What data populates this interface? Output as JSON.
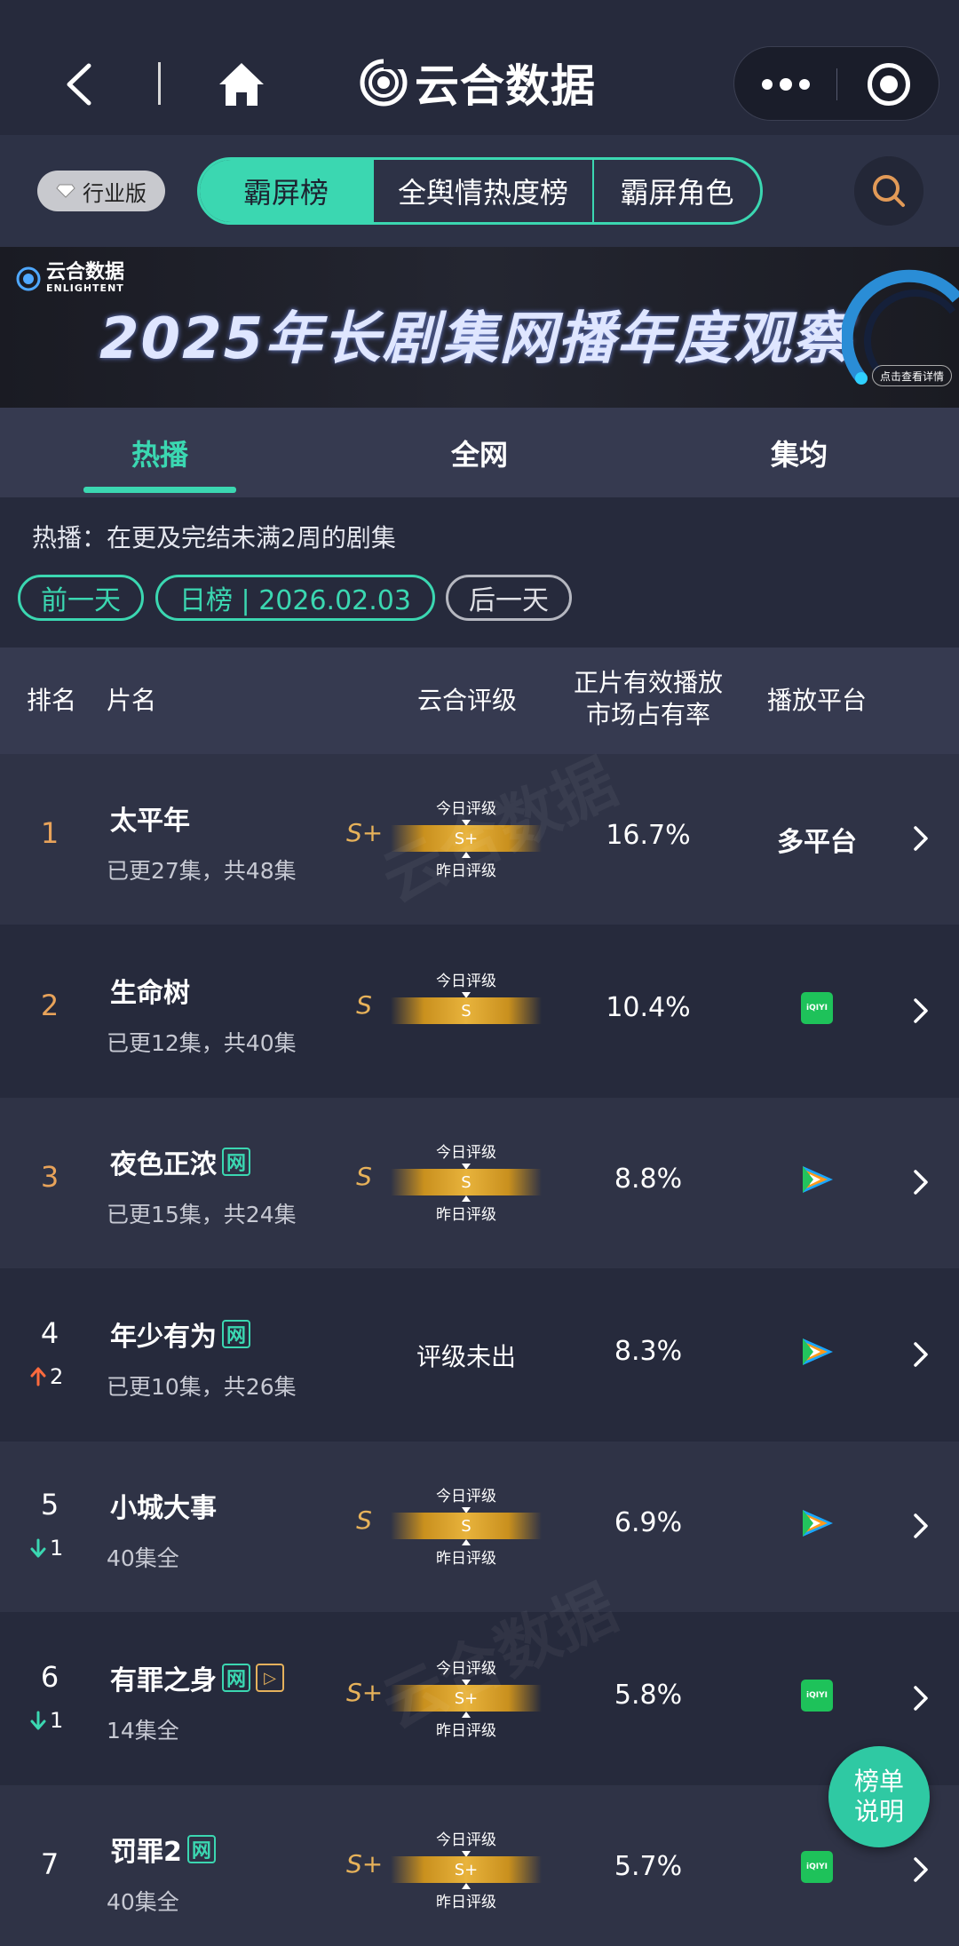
{
  "app": {
    "title": "云合数据"
  },
  "toolbar": {
    "edition_label": "行业版",
    "segments": [
      "霸屏榜",
      "全舆情热度榜",
      "霸屏角色"
    ]
  },
  "banner": {
    "logo_cn": "云合数据",
    "logo_en": "ENLIGHTENT",
    "title": "2025年长剧集网播年度观察",
    "detail_label": "点击查看详情"
  },
  "subtabs": [
    "热播",
    "全网",
    "集均"
  ],
  "description": "热播：在更及完结未满2周的剧集",
  "date_nav": {
    "prev": "前一天",
    "current": "日榜 | 2026.02.03",
    "next": "后一天"
  },
  "table": {
    "headers": {
      "rank": "排名",
      "name": "片名",
      "grade": "云合评级",
      "share_line1": "正片有效播放",
      "share_line2": "市场占有率",
      "platform": "播放平台"
    },
    "today_label": "今日评级",
    "yesterday_label": "昨日评级",
    "web_badge": "网",
    "rows": [
      {
        "rank": "1",
        "change": "",
        "change_dir": "",
        "title": "太平年",
        "web": false,
        "extra_badge": false,
        "sub": "已更27集，共48集",
        "grade": "S+",
        "today": "S+",
        "yesterday": true,
        "share": "16.7%",
        "platform_text": "多平台",
        "platform_icon": ""
      },
      {
        "rank": "2",
        "change": "",
        "change_dir": "",
        "title": "生命树",
        "web": false,
        "extra_badge": false,
        "sub": "已更12集，共40集",
        "grade": "S",
        "today": "S",
        "yesterday": false,
        "share": "10.4%",
        "platform_text": "",
        "platform_icon": "iqiyi"
      },
      {
        "rank": "3",
        "change": "",
        "change_dir": "",
        "title": "夜色正浓",
        "web": true,
        "extra_badge": false,
        "sub": "已更15集，共24集",
        "grade": "S",
        "today": "S",
        "yesterday": true,
        "share": "8.8%",
        "platform_text": "",
        "platform_icon": "tencent"
      },
      {
        "rank": "4",
        "change": "2",
        "change_dir": "up",
        "title": "年少有为",
        "web": true,
        "extra_badge": false,
        "sub": "已更10集，共26集",
        "grade": "",
        "today": "",
        "yesterday": false,
        "no_grade": "评级未出",
        "share": "8.3%",
        "platform_text": "",
        "platform_icon": "tencent"
      },
      {
        "rank": "5",
        "change": "1",
        "change_dir": "down",
        "title": "小城大事",
        "web": false,
        "extra_badge": false,
        "sub": "40集全",
        "grade": "S",
        "today": "S",
        "yesterday": true,
        "share": "6.9%",
        "platform_text": "",
        "platform_icon": "tencent"
      },
      {
        "rank": "6",
        "change": "1",
        "change_dir": "down",
        "title": "有罪之身",
        "web": true,
        "extra_badge": true,
        "sub": "14集全",
        "grade": "S+",
        "today": "S+",
        "yesterday": true,
        "share": "5.8%",
        "platform_text": "",
        "platform_icon": "iqiyi"
      },
      {
        "rank": "7",
        "change": "",
        "change_dir": "",
        "title": "罚罪2",
        "web": true,
        "extra_badge": false,
        "sub": "40集全",
        "grade": "S+",
        "today": "S+",
        "yesterday": true,
        "share": "5.7%",
        "platform_text": "",
        "platform_icon": "iqiyi"
      }
    ]
  },
  "fab": {
    "line1": "榜单",
    "line2": "说明"
  },
  "icons": {
    "iqiyi_text": "iQIYI"
  },
  "colors": {
    "accent": "#3bd7b1",
    "grade": "#e7b25a",
    "rank_top": "#e8a35a",
    "up": "#ff6a3d",
    "down": "#3bd7b1",
    "bg": "#262a3c"
  }
}
